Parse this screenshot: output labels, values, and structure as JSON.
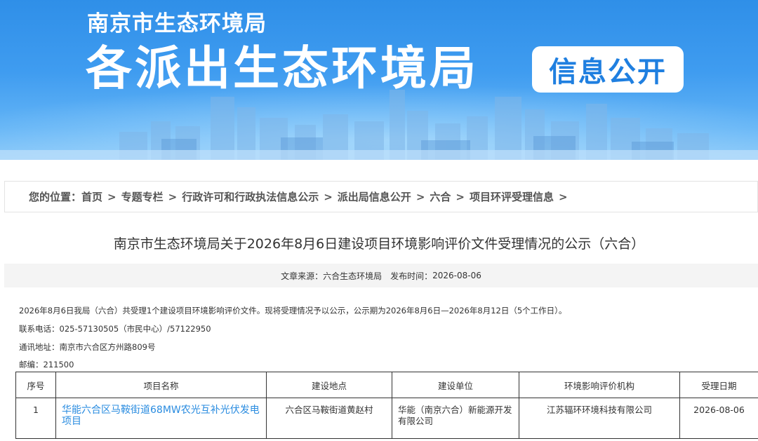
{
  "banner": {
    "org_name": "南京市生态环境局",
    "headline": "各派出生态环境局",
    "badge": "信息公开"
  },
  "breadcrumb": {
    "lead": "您的位置：",
    "items": [
      "首页",
      "专题专栏",
      "行政许可和行政执法信息公示",
      "派出局信息公开",
      "六合",
      "项目环评受理信息"
    ],
    "separator": ">"
  },
  "article": {
    "title": "南京市生态环境局关于2026年8月6日建设项目环境影响评价文件受理情况的公示（六合）",
    "meta": {
      "source_label": "文章来源：",
      "source": "六合生态环境局",
      "date_label": "发布时间：",
      "date": "2026-08-06"
    },
    "paragraphs": [
      "2026年8月6日我局（六合）共受理1个建设项目环境影响评价文件。现将受理情况予以公示，公示期为2026年8月6日—2026年8月12日（5个工作日）。",
      "联系电话：025-57130505（市民中心）/57122950",
      "通讯地址：南京市六合区方州路809号",
      "邮编：211500"
    ]
  },
  "table": {
    "headers": [
      "序号",
      "项目名称",
      "建设地点",
      "建设单位",
      "环境影响评价机构",
      "受理日期"
    ],
    "rows": [
      {
        "no": "1",
        "name": "华能六合区马鞍街道68MW农光互补光伏发电项目",
        "location": "六合区马鞍街道黄赵村",
        "unit": "华能（南京六合）新能源开发有限公司",
        "agency": "江苏辐环环境科技有限公司",
        "date": "2026-08-06"
      }
    ]
  },
  "colors": {
    "banner_blue": "#3f9cf0",
    "link_blue": "#2a8ce0",
    "badge_text": "#1f7fe0"
  }
}
